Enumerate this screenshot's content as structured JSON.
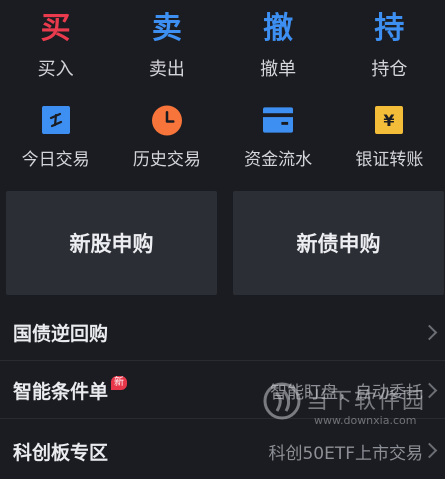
{
  "colors": {
    "background": "#1b1c21",
    "card": "#2c2e35",
    "buy_red": "#ea3b4e",
    "blue": "#3d8ff2",
    "orange": "#f7743a",
    "gold": "#f3bd3a"
  },
  "actions": [
    {
      "glyph": "买",
      "label": "买入",
      "color": "#ea3b4e"
    },
    {
      "glyph": "卖",
      "label": "卖出",
      "color": "#3d8ff2"
    },
    {
      "glyph": "撤",
      "label": "撤单",
      "color": "#3d8ff2"
    },
    {
      "glyph": "持",
      "label": "持仓",
      "color": "#3d8ff2"
    }
  ],
  "icon_actions": [
    {
      "icon": "today-trade-icon",
      "label": "今日交易"
    },
    {
      "icon": "clock-icon",
      "label": "历史交易"
    },
    {
      "icon": "card-icon",
      "label": "资金流水"
    },
    {
      "icon": "yuan-transfer-icon",
      "label": "银证转账",
      "glyph": "¥"
    }
  ],
  "cards": {
    "ipo_stock": "新股申购",
    "ipo_bond": "新债申购"
  },
  "list": [
    {
      "title": "国债逆回购",
      "subtitle": "",
      "badge": ""
    },
    {
      "title": "智能条件单",
      "subtitle": "智能盯盘，自动委托",
      "badge": "新"
    },
    {
      "title": "科创板专区",
      "subtitle": "科创50ETF上市交易",
      "badge": ""
    }
  ],
  "watermark": {
    "name": "当下软件园",
    "url": "www.downxia.com"
  }
}
